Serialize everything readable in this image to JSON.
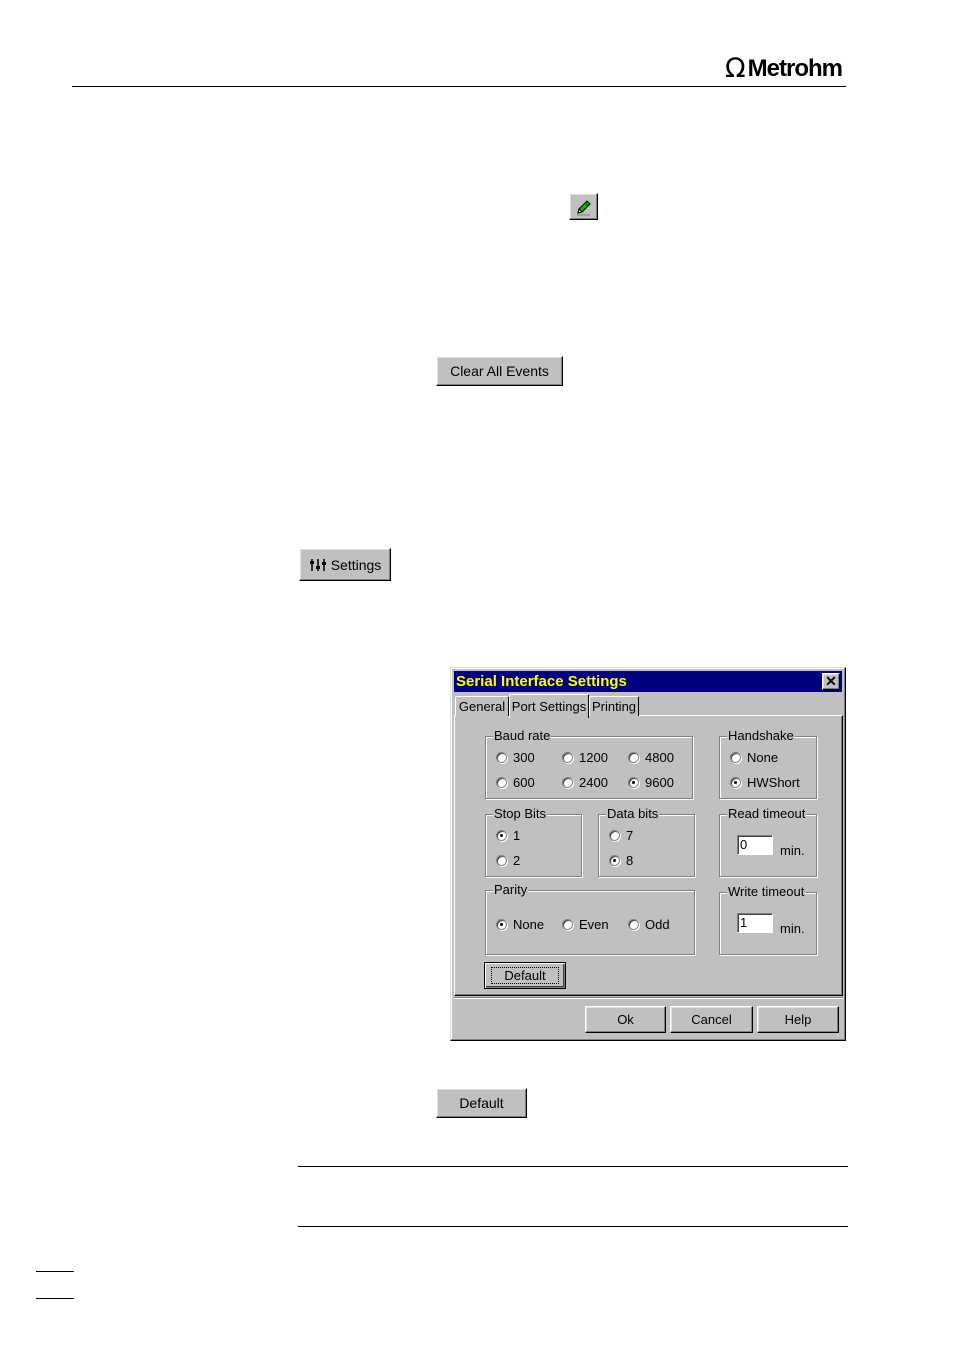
{
  "header": {
    "logo_symbol": "Ω",
    "logo_text": "Metrohm"
  },
  "buttons": {
    "clear_all_events": "Clear All Events",
    "settings": "Settings",
    "default": "Default"
  },
  "icons": {
    "pencil": "pencil-icon",
    "settings": "sliders-icon"
  },
  "dialog": {
    "title": "Serial Interface Settings",
    "close_label": "✕",
    "tabs": [
      "General",
      "Port Settings",
      "Printing"
    ],
    "active_tab": "Port Settings",
    "baud_rate": {
      "label": "Baud rate",
      "options": [
        "300",
        "1200",
        "4800",
        "600",
        "2400",
        "9600"
      ],
      "selected": "9600"
    },
    "handshake": {
      "label": "Handshake",
      "options": [
        "None",
        "HWShort"
      ],
      "selected": "HWShort"
    },
    "stop_bits": {
      "label": "Stop Bits",
      "options": [
        "1",
        "2"
      ],
      "selected": "1"
    },
    "data_bits": {
      "label": "Data bits",
      "options": [
        "7",
        "8"
      ],
      "selected": "8"
    },
    "read_timeout": {
      "label": "Read timeout",
      "value": "0",
      "unit": "min."
    },
    "parity": {
      "label": "Parity",
      "options": [
        "None",
        "Even",
        "Odd"
      ],
      "selected": "None"
    },
    "write_timeout": {
      "label": "Write timeout",
      "value": "1",
      "unit": "min."
    },
    "default_label": "Default",
    "ok_label": "Ok",
    "cancel_label": "Cancel",
    "help_label": "Help"
  },
  "colors": {
    "titlebar": "#000080",
    "title_text": "#ffff00",
    "face": "#c0c0c0"
  }
}
